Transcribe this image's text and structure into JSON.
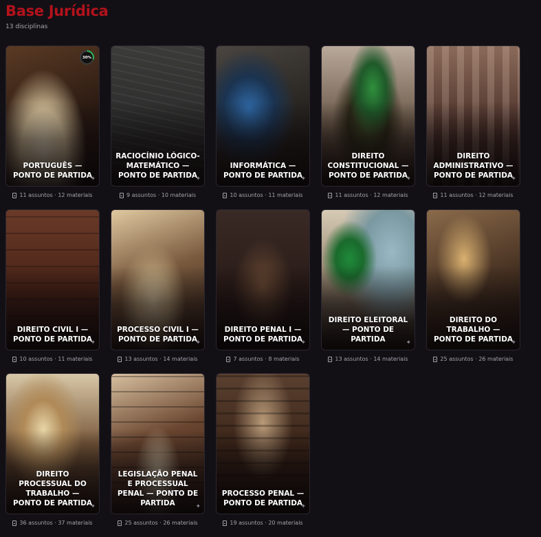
{
  "header": {
    "title": "Base Jurídica",
    "subtitle": "13 disciplinas"
  },
  "cards": [
    {
      "label": "PORTUGUÊS — PONTO DE PARTIDA",
      "meta": "11 assuntos · 12 materiais",
      "progress": "30%",
      "progress_value": 0.3,
      "scene": "old-letter-and-pen"
    },
    {
      "label": "RACIOCÍNIO LÓGICO-MATEMÁTICO — PONTO DE PARTIDA",
      "meta": "9 assuntos · 10 materiais",
      "scene": "chalkboard-formulas"
    },
    {
      "label": "INFORMÁTICA — PONTO DE PARTIDA",
      "meta": "10 assuntos · 11 materiais",
      "scene": "laptop-and-circuit-board"
    },
    {
      "label": "DIREITO CONSTITUCIONAL — PONTO DE PARTIDA",
      "meta": "11 assuntos · 12 materiais",
      "scene": "constitution-book-and-flag"
    },
    {
      "label": "DIREITO ADMINISTRATIVO — PONTO DE PARTIDA",
      "meta": "11 assuntos · 12 materiais",
      "scene": "columns-and-stamp"
    },
    {
      "label": "DIREITO CIVIL I — PONTO DE PARTIDA",
      "meta": "10 assuntos · 11 materiais",
      "scene": "bookshelf-and-seal"
    },
    {
      "label": "PROCESSO CIVIL I — PONTO DE PARTIDA",
      "meta": "13 assuntos · 14 materiais",
      "scene": "tied-documents-and-gavel"
    },
    {
      "label": "DIREITO PENAL I — PONTO DE PARTIDA",
      "meta": "7 assuntos · 8 materiais",
      "scene": "dark-courtroom-scale"
    },
    {
      "label": "DIREITO ELEITORAL — PONTO DE PARTIDA",
      "meta": "13 assuntos · 14 materiais",
      "scene": "flag-map-ballot-box"
    },
    {
      "label": "DIREITO DO TRABALHO — PONTO DE PARTIDA",
      "meta": "25 assuntos · 26 materiais",
      "scene": "scale-gears-book"
    },
    {
      "label": "DIREITO PROCESSUAL DO TRABALHO — PONTO DE PARTIDA",
      "meta": "36 assuntos · 37 materiais",
      "scene": "clt-book-and-courtroom"
    },
    {
      "label": "LEGISLAÇÃO PENAL E PROCESSUAL PENAL — PONTO DE PARTIDA",
      "meta": "25 assuntos · 26 materiais",
      "scene": "library-open-book"
    },
    {
      "label": "PROCESSO PENAL — PONTO DE PARTIDA",
      "meta": "19 assuntos · 20 materiais",
      "scene": "courtroom-benches"
    }
  ]
}
